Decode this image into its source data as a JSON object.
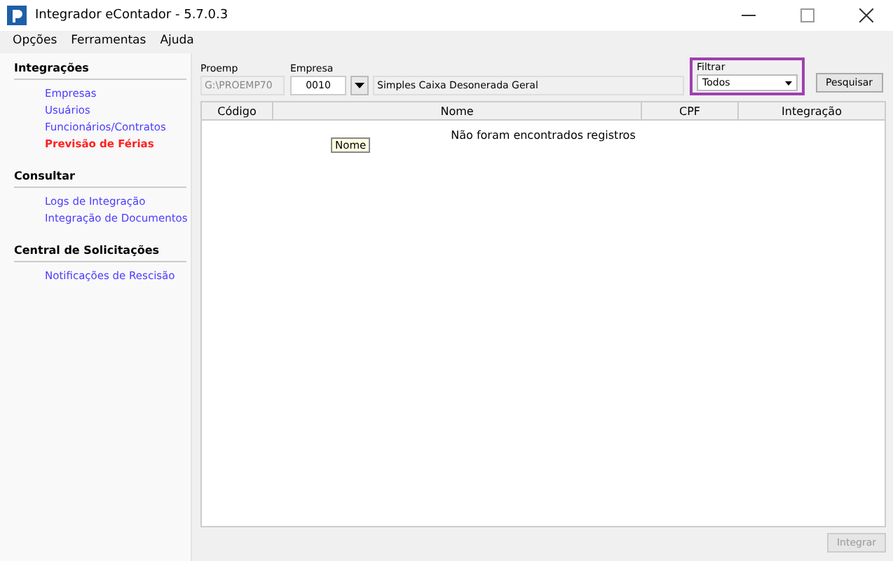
{
  "window": {
    "title": "Integrador eContador - 5.7.0.3"
  },
  "menu": [
    "Opções",
    "Ferramentas",
    "Ajuda"
  ],
  "sidebar": [
    {
      "title": "Integrações",
      "items": [
        {
          "label": "Empresas",
          "selected": false
        },
        {
          "label": "Usuários",
          "selected": false
        },
        {
          "label": "Funcionários/Contratos",
          "selected": false
        },
        {
          "label": "Previsão de Férias",
          "selected": true
        }
      ]
    },
    {
      "title": "Consultar",
      "items": [
        {
          "label": "Logs de Integração",
          "selected": false
        },
        {
          "label": "Integração de Documentos",
          "selected": false
        }
      ]
    },
    {
      "title": "Central de Solicitações",
      "items": [
        {
          "label": "Notificações de Rescisão",
          "selected": false
        }
      ]
    }
  ],
  "proemp": {
    "label": "Proemp",
    "value": "G:\\PROEMP70",
    "disabled": true
  },
  "empresa": {
    "label": "Empresa",
    "code": "0010",
    "name": "Simples Caixa Desonerada Geral"
  },
  "filter": {
    "label": "Filtrar",
    "value": "Todos",
    "highlighted": true
  },
  "search_button": {
    "label": "Pesquisar"
  },
  "table": {
    "columns": [
      "Código",
      "Nome",
      "CPF",
      "Integração"
    ],
    "empty_message": "Não foram encontrados registros",
    "tooltip": "Nome"
  },
  "integrate_button": {
    "label": "Integrar",
    "disabled": true
  }
}
